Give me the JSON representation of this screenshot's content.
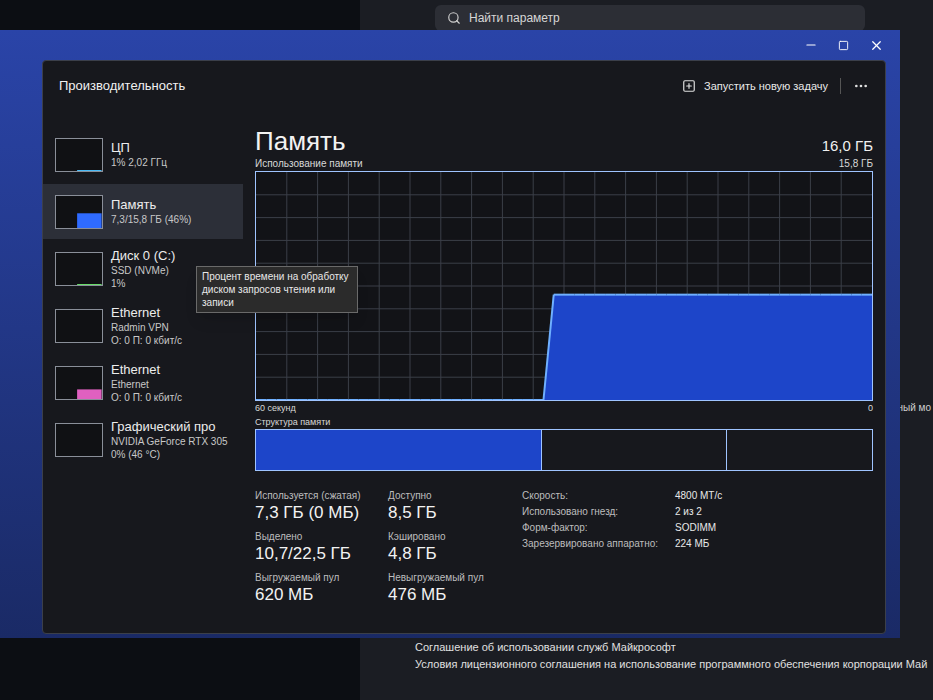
{
  "background_window": {
    "search": {
      "placeholder": "Найти параметр"
    },
    "side_text": "ный мо",
    "links": [
      "Соглашение об использовании служб Майкрософт",
      "Условия лицензионного соглашения на использование программного обеспечения корпорации Май"
    ]
  },
  "window": {
    "title": "Производительность",
    "actions": [
      {
        "label": "Запустить новую задачу"
      }
    ]
  },
  "sidebar": {
    "items": [
      {
        "title": "ЦП",
        "lines": [
          "1% 2,02 ГГц"
        ],
        "selected": false,
        "level": 0.03,
        "color": "#4cc2ff"
      },
      {
        "title": "Память",
        "lines": [
          "7,3/15,8 ГБ (46%)"
        ],
        "selected": true,
        "level": 0.46,
        "color": "#2f6bff"
      },
      {
        "title": "Диск 0 (C:)",
        "lines": [
          "SSD (NVMe)",
          "1%"
        ],
        "selected": false,
        "level": 0.03,
        "color": "#6ee56e"
      },
      {
        "title": "Ethernet",
        "lines": [
          "Radmin VPN",
          "О: 0 П: 0 кбит/с"
        ],
        "selected": false,
        "level": 0.0,
        "color": "#c86bd6"
      },
      {
        "title": "Ethernet",
        "lines": [
          "Ethernet",
          "О: 0 П: 0 кбит/с"
        ],
        "selected": false,
        "level": 0.3,
        "color": "#e060c0"
      },
      {
        "title": "Графический про",
        "lines": [
          "NVIDIA GeForce RTX 305",
          "0% (46 °C)"
        ],
        "selected": false,
        "level": 0.0,
        "color": "#4cc2ff"
      }
    ]
  },
  "tooltip": {
    "text": "Процент времени на обработку диском запросов чтения или записи"
  },
  "main": {
    "title": "Память",
    "total": "16,0 ГБ"
  },
  "chart": {
    "title": "Использование памяти",
    "max_label": "15,8 ГБ",
    "max_value": 15.8,
    "x_start": "60 секунд",
    "x_end": "0",
    "series": [
      {
        "name": "Используется",
        "values": [
          0,
          0,
          0,
          0,
          0,
          0,
          0,
          0,
          0,
          0,
          0,
          0,
          0,
          0,
          0,
          0,
          0,
          0,
          0,
          0,
          0,
          0,
          0,
          0,
          0,
          0,
          0,
          0,
          0,
          7.3,
          7.3,
          7.3,
          7.3,
          7.3,
          7.3,
          7.3,
          7.3,
          7.3,
          7.3,
          7.3,
          7.3,
          7.3,
          7.3,
          7.3,
          7.3,
          7.3,
          7.3,
          7.3,
          7.3,
          7.3,
          7.3,
          7.3,
          7.3,
          7.3,
          7.3,
          7.3,
          7.3,
          7.3,
          7.3,
          7.3,
          7.3
        ]
      }
    ]
  },
  "structure": {
    "title": "Структура памяти",
    "segments": [
      {
        "level": 0.465,
        "filled": true
      },
      {
        "level": 0.3,
        "filled": false
      },
      {
        "level": 0.235,
        "filled": false
      }
    ]
  },
  "stats": [
    {
      "label": "Используется (сжатая)",
      "value": "7,3 ГБ (0 МБ)"
    },
    {
      "label": "Доступно",
      "value": "8,5 ГБ"
    },
    {
      "label": "Выделено",
      "value": "10,7/22,5 ГБ"
    },
    {
      "label": "Кэшировано",
      "value": "4,8 ГБ"
    },
    {
      "label": "Выгружаемый пул",
      "value": "620 МБ"
    },
    {
      "label": "Невыгружаемый пул",
      "value": "476 МБ"
    }
  ],
  "details": [
    {
      "label": "Скорость:",
      "value": "4800 МТ/с"
    },
    {
      "label": "Использовано гнезд:",
      "value": "2 из 2"
    },
    {
      "label": "Форм-фактор:",
      "value": "SODIMM"
    },
    {
      "label": "Зарезервировано аппаратно:",
      "value": "224 МБ"
    }
  ]
}
